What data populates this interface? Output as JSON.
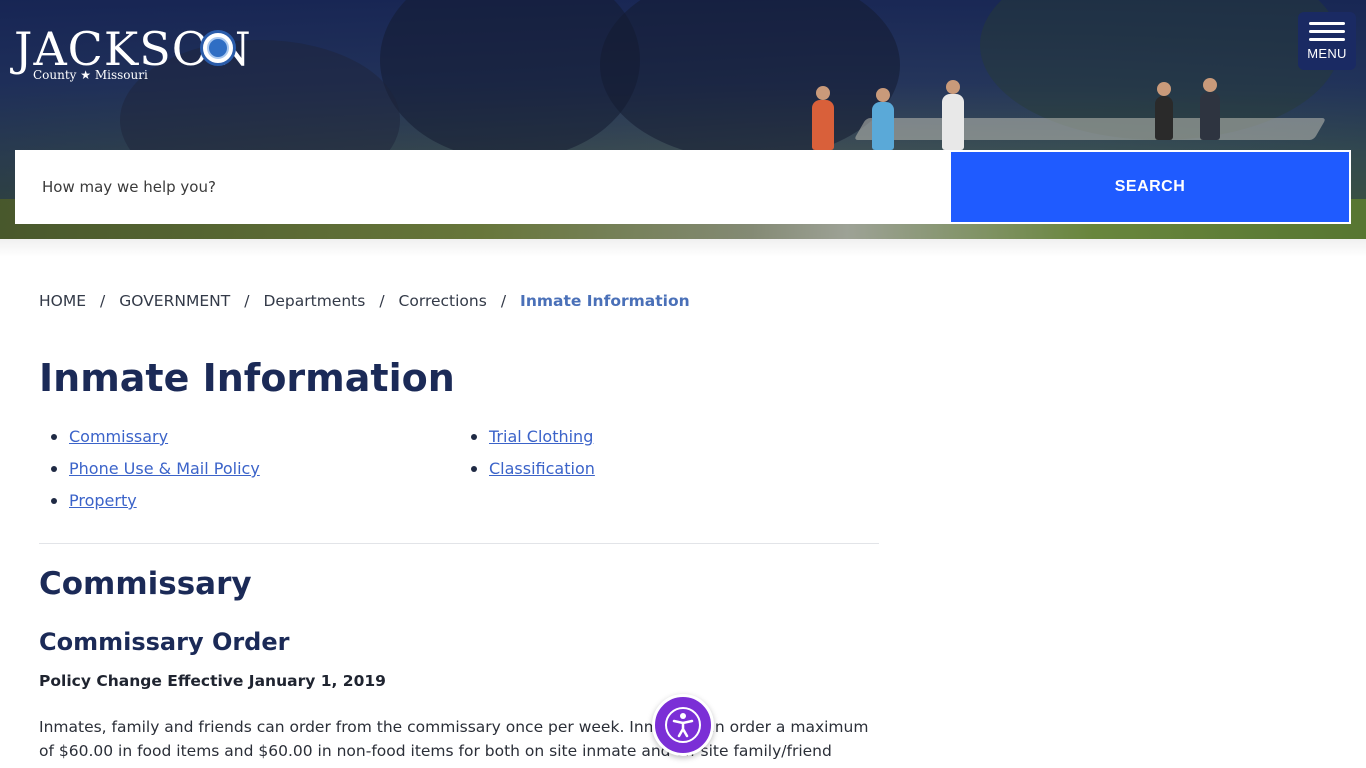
{
  "header": {
    "logo_word": "JACKSON",
    "logo_sub": "County ★ Missouri",
    "menu_label": "MENU"
  },
  "search": {
    "placeholder": "How may we help you?",
    "button_label": "SEARCH"
  },
  "breadcrumb": {
    "items": [
      "HOME",
      "GOVERNMENT",
      "Departments",
      "Corrections"
    ],
    "current": "Inmate Information",
    "separator": "/"
  },
  "page": {
    "title": "Inmate Information",
    "links_col1": [
      "Commissary",
      "Phone Use & Mail Policy",
      "Property"
    ],
    "links_col2": [
      "Trial Clothing",
      "Classification"
    ]
  },
  "content": {
    "section_title": "Commissary",
    "subsection_title": "Commissary Order",
    "policy_note": "Policy Change Effective January 1, 2019",
    "paragraph": "Inmates, family and friends can order from the commissary once per week. Inmates can order a maximum of $60.00 in food items and $60.00 in non-food items for both on site inmate and off site family/friend purchases."
  },
  "colors": {
    "primary_navy": "#1b2a57",
    "search_blue": "#1f5bff",
    "link_blue": "#3b63c9",
    "breadcrumb_current": "#4a70b8",
    "accessibility_purple": "#7b2fd6"
  },
  "icons": {
    "menu": "hamburger-icon",
    "accessibility": "accessibility-icon",
    "seal": "county-seal-icon"
  }
}
